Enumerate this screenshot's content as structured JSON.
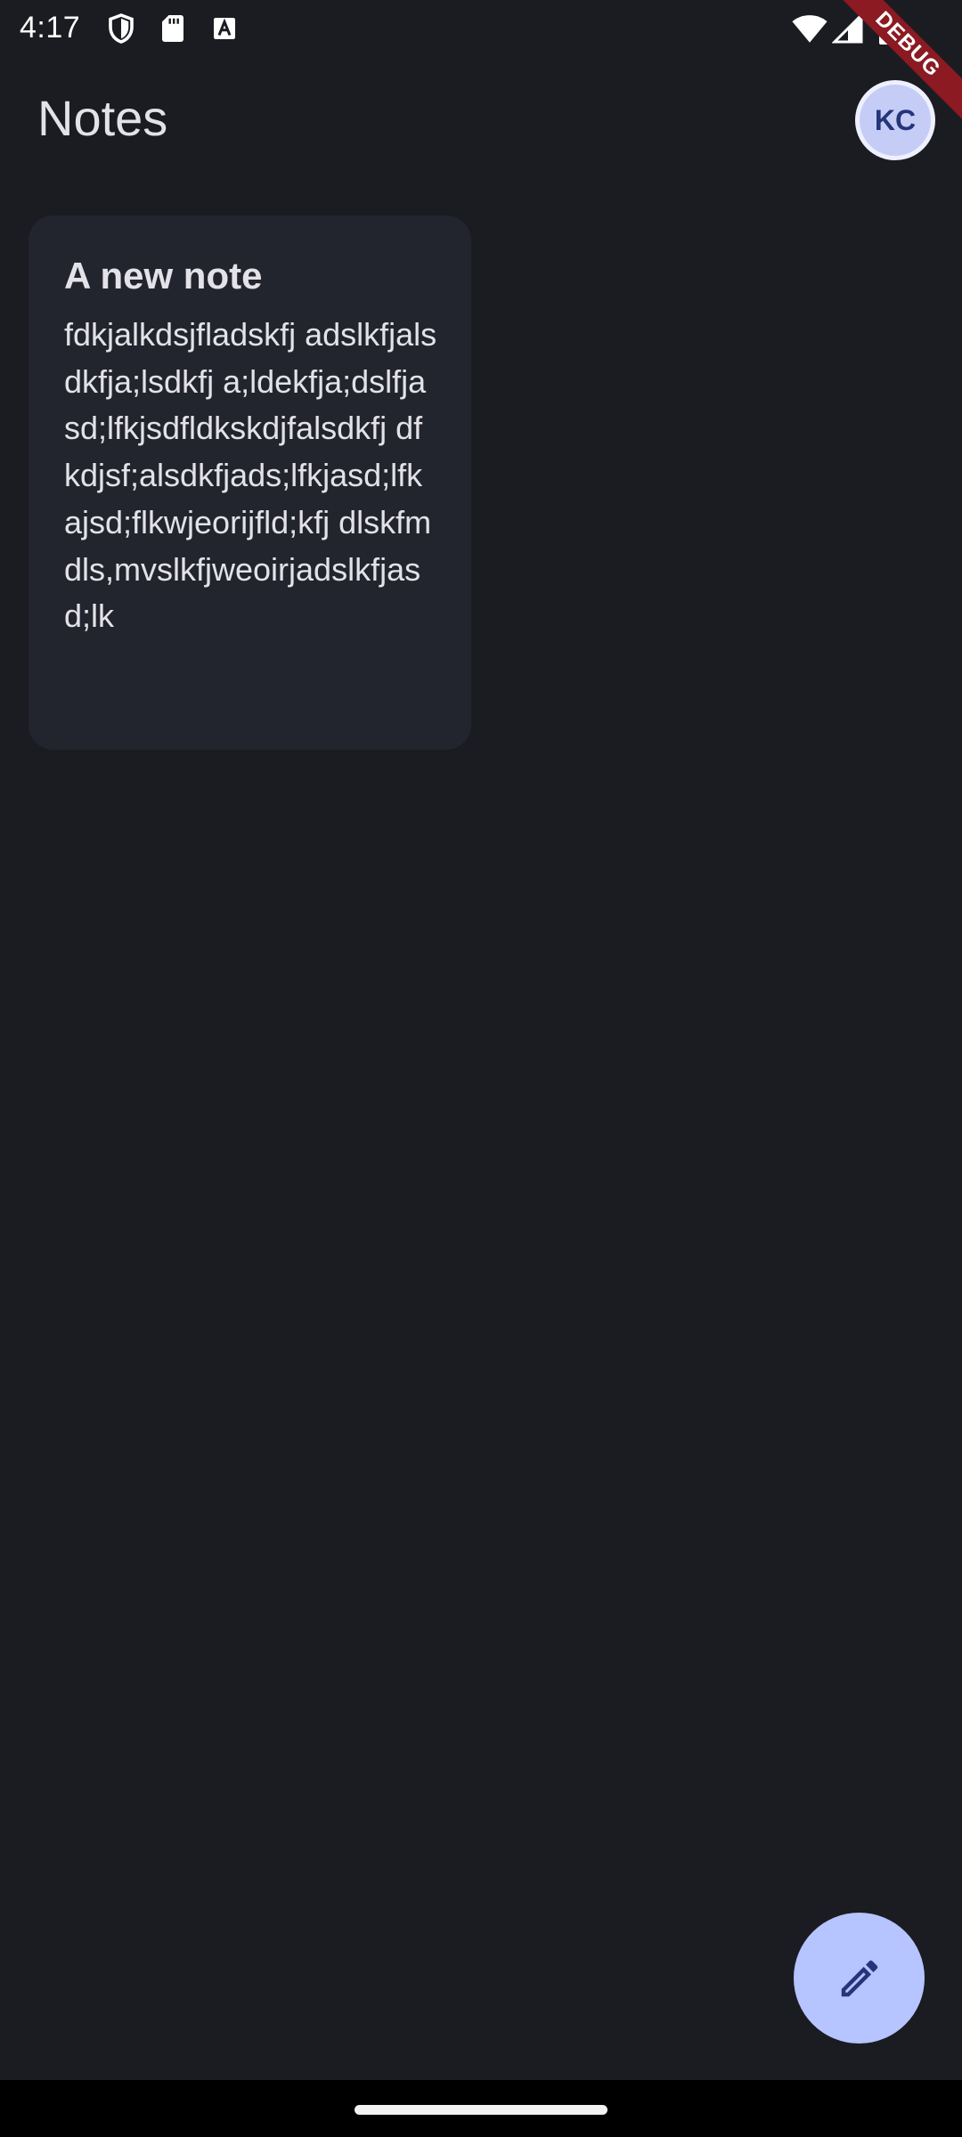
{
  "status_bar": {
    "time": "4:17",
    "left_icons": [
      "shield-icon",
      "sd-card-icon",
      "a-font-icon"
    ],
    "right_icons": [
      "wifi-icon",
      "cellular-signal-icon",
      "battery-icon"
    ]
  },
  "debug_banner": "DEBUG",
  "app_bar": {
    "title": "Notes",
    "avatar_initials": "KC"
  },
  "notes": [
    {
      "title": "A new note",
      "body": "fdkjalkdsjfladskfj adslkfjalsdkfja;lsdkfj a;ldekfja;dslfjasd;lfkjsdfldkskdjfalsdkfj dfkdjsf;alsdkfjads;lfkjasd;lfkajsd;flkwjeorijfld;kfj dlskfm dls,mvslkfjweoirjadslkfjasd;lk"
    }
  ],
  "fab": {
    "icon": "pencil-icon"
  },
  "colors": {
    "background": "#1b1c21",
    "card": "#23252e",
    "accent": "#b6c4ff",
    "avatar": "#c5cdf7",
    "debug_ribbon": "#8b1a22"
  }
}
